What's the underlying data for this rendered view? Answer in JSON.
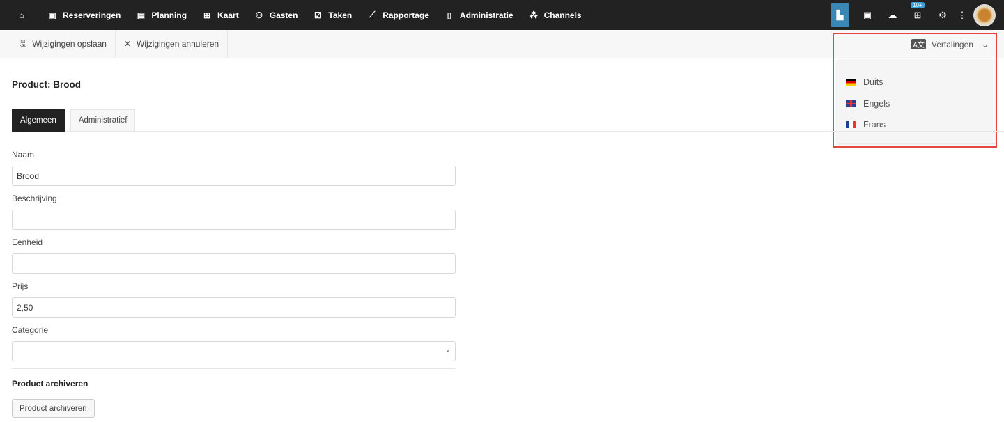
{
  "nav": [
    {
      "label": "",
      "icon": "home-icon",
      "glyph": "⌂"
    },
    {
      "label": "Reserveringen",
      "icon": "book-icon",
      "glyph": "▣"
    },
    {
      "label": "Planning",
      "icon": "calendar-icon",
      "glyph": "▤"
    },
    {
      "label": "Kaart",
      "icon": "map-icon",
      "glyph": "⊞"
    },
    {
      "label": "Gasten",
      "icon": "users-icon",
      "glyph": "⚇"
    },
    {
      "label": "Taken",
      "icon": "clipboard-icon",
      "glyph": "☑"
    },
    {
      "label": "Rapportage",
      "icon": "chart-line-icon",
      "glyph": "⟋"
    },
    {
      "label": "Administratie",
      "icon": "ledger-icon",
      "glyph": "▯"
    },
    {
      "label": "Channels",
      "icon": "network-icon",
      "glyph": "⁂"
    }
  ],
  "header_right": {
    "badge": "10+"
  },
  "toolbar": {
    "save": "Wijzigingen opslaan",
    "cancel": "Wijzigingen annuleren",
    "translations": "Vertalingen"
  },
  "translations_menu": [
    "Duits",
    "Engels",
    "Frans"
  ],
  "page_title": "Product: Brood",
  "tabs": [
    "Algemeen",
    "Administratief"
  ],
  "form": {
    "naam": {
      "label": "Naam",
      "value": "Brood"
    },
    "beschrijving": {
      "label": "Beschrijving",
      "value": ""
    },
    "eenheid": {
      "label": "Eenheid",
      "value": ""
    },
    "prijs": {
      "label": "Prijs",
      "value": "2,50"
    },
    "categorie": {
      "label": "Categorie",
      "value": ""
    }
  },
  "archive": {
    "heading": "Product archiveren",
    "button": "Product archiveren"
  },
  "colors": {
    "topbar": "#222222",
    "active_icon": "#3a86b4",
    "highlight": "#e5473b"
  }
}
